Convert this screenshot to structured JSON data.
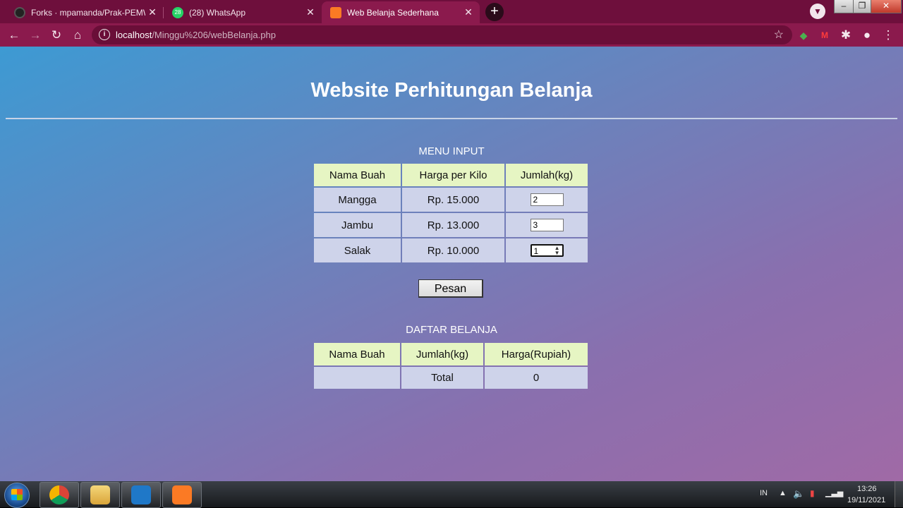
{
  "browser": {
    "tabs": [
      {
        "title": "Forks · mpamanda/Prak-PEMWEB",
        "favicon": "github-icon"
      },
      {
        "title": "(28) WhatsApp",
        "favicon": "whatsapp-icon",
        "badge": "28"
      },
      {
        "title": "Web Belanja Sederhana",
        "favicon": "xampp-icon",
        "active": true
      }
    ],
    "url_host": "localhost",
    "url_path": "/Minggu%206/webBelanja.php"
  },
  "page": {
    "title": "Website Perhitungan Belanja",
    "menu_input": {
      "caption": "MENU INPUT",
      "headers": [
        "Nama Buah",
        "Harga per Kilo",
        "Jumlah(kg)"
      ],
      "rows": [
        {
          "name": "Mangga",
          "price": "Rp. 15.000",
          "qty": "2"
        },
        {
          "name": "Jambu",
          "price": "Rp. 13.000",
          "qty": "3"
        },
        {
          "name": "Salak",
          "price": "Rp. 10.000",
          "qty": "1"
        }
      ],
      "submit_label": "Pesan"
    },
    "daftar_belanja": {
      "caption": "DAFTAR BELANJA",
      "headers": [
        "Nama Buah",
        "Jumlah(kg)",
        "Harga(Rupiah)"
      ],
      "total_label": "Total",
      "total_value": "0"
    }
  },
  "taskbar": {
    "lang": "IN",
    "time": "13:26",
    "date": "19/11/2021"
  },
  "colors": {
    "tabbar": "#6e0f3c",
    "toolbar": "#8b1a4d",
    "header_cell": "#e6f5c3",
    "body_cell": "#ced3ea"
  }
}
